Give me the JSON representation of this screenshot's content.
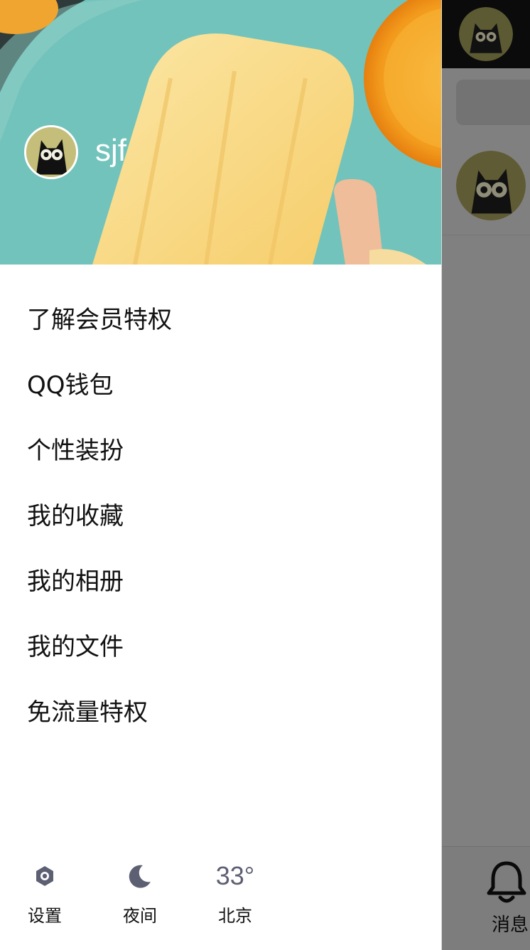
{
  "profile": {
    "name": "sjf"
  },
  "menu": {
    "items": [
      {
        "label": "了解会员特权"
      },
      {
        "label": "QQ钱包"
      },
      {
        "label": "个性装扮"
      },
      {
        "label": "我的收藏"
      },
      {
        "label": "我的相册"
      },
      {
        "label": "我的文件"
      },
      {
        "label": "免流量特权"
      }
    ]
  },
  "bottom_bar": {
    "settings_label": "设置",
    "night_label": "夜间",
    "weather_temp": "33°",
    "weather_city": "北京"
  },
  "background_page": {
    "tab_messages_label": "消息"
  },
  "colors": {
    "icon_color": "#5d5f73",
    "overlay": "#808080",
    "header_teal": "#6cbcb4"
  }
}
